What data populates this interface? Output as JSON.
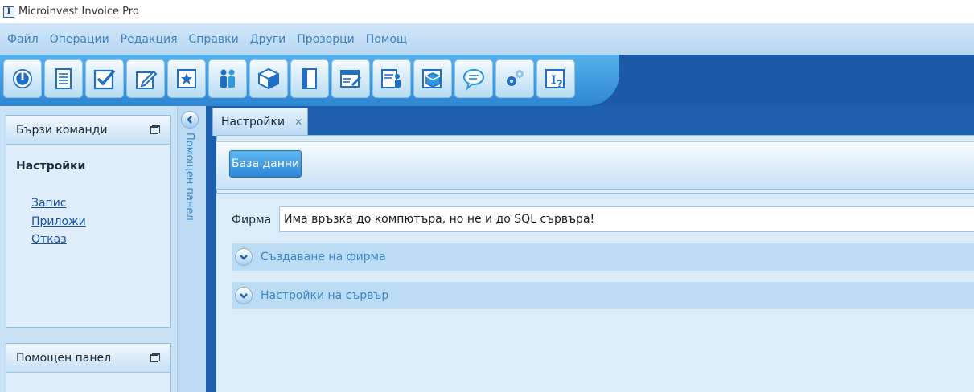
{
  "window": {
    "title": "Microinvest Invoice Pro"
  },
  "menu": {
    "items": [
      "Файл",
      "Операции",
      "Редакция",
      "Справки",
      "Други",
      "Прозорци",
      "Помощ"
    ]
  },
  "toolbar": {
    "icons": [
      "power-icon",
      "document-icon",
      "checkbox-icon",
      "edit-icon",
      "star-icon",
      "people-icon",
      "box-icon",
      "book-icon",
      "form-edit-icon",
      "person-card-icon",
      "box-card-icon",
      "chat-bubble-icon",
      "gears-icon",
      "help-card-icon"
    ]
  },
  "quick_commands": {
    "title": "Бързи команди",
    "section_title": "Настройки",
    "links": [
      "Запис",
      "Приложи",
      "Отказ"
    ]
  },
  "help_panel": {
    "title": "Помощен панел",
    "vertical_label": "Помощен панел"
  },
  "tab": {
    "label": "Настройки"
  },
  "main": {
    "db_button": "База данни",
    "firm_label": "Фирма",
    "firm_value": "Има връзка до компютъра, но не и до SQL сървъра!",
    "sections": [
      "Създаване на фирма",
      "Настройки на сървър"
    ]
  },
  "colors": {
    "menu_text": "#3d7fbf",
    "link": "#1650a8",
    "accent_blue": "#1e5fad",
    "section_text": "#3a86c8"
  }
}
